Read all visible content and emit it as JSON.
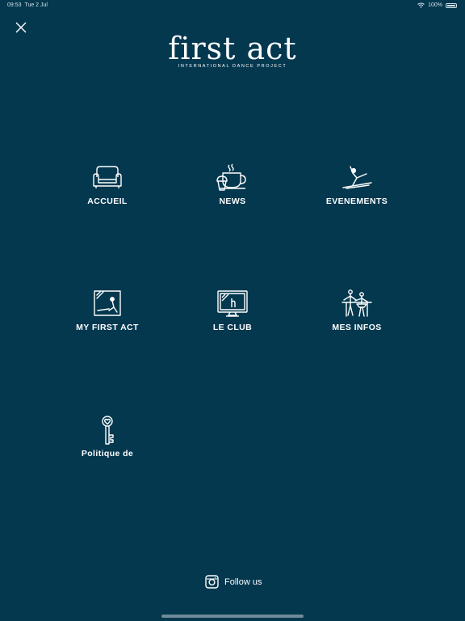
{
  "status_bar": {
    "time": "09:53",
    "date": "Tue 2 Jul",
    "battery": "100%"
  },
  "brand": {
    "name": "first act",
    "tagline": "INTERNATIONAL DANCE PROJECT"
  },
  "menu": {
    "items": [
      {
        "label": "ACCUEIL",
        "icon": "armchair-icon"
      },
      {
        "label": "NEWS",
        "icon": "coffee-cup-muffin-icon"
      },
      {
        "label": "EVENEMENTS",
        "icon": "dancer-icon"
      },
      {
        "label": "MY FIRST ACT",
        "icon": "framed-dancer-icon"
      },
      {
        "label": "LE CLUB",
        "icon": "monitor-icon"
      },
      {
        "label": "MES INFOS",
        "icon": "dancers-icon"
      },
      {
        "label": "Politique de",
        "icon": "heart-key-icon"
      }
    ]
  },
  "footer": {
    "follow_label": "Follow us",
    "icon": "instagram-icon"
  },
  "colors": {
    "background": "#03384f",
    "foreground": "#ffffff"
  }
}
